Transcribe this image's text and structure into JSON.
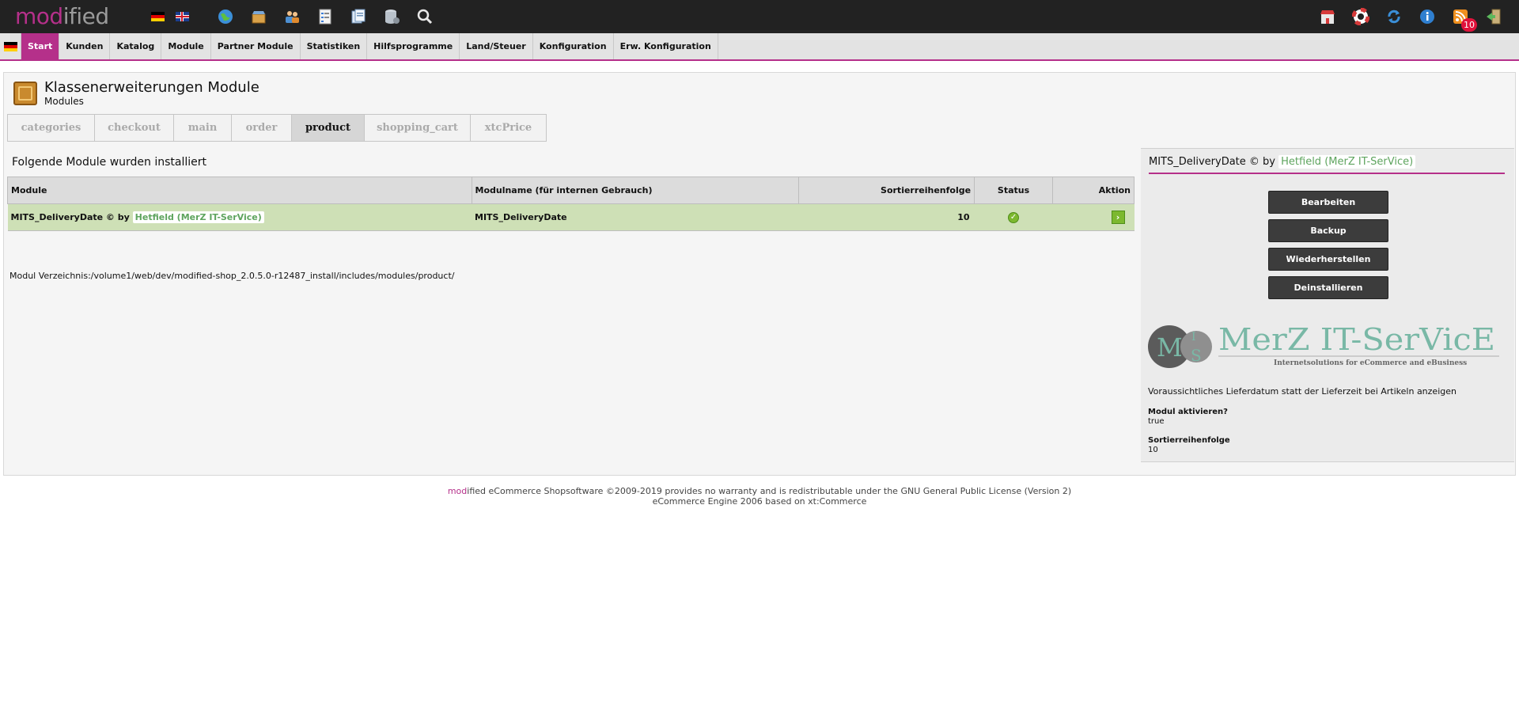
{
  "brand": {
    "logo_part1": "mod",
    "logo_part2": "ified",
    "accent": "#b5308a"
  },
  "topbar": {
    "flags": [
      "flag-de-icon",
      "flag-en-icon"
    ],
    "icons": [
      "globe-icon",
      "basket-icon",
      "users-icon",
      "checklist-icon",
      "documents-icon",
      "database-icon",
      "search-icon"
    ],
    "right_icons": [
      "shop-icon",
      "lifebuoy-icon",
      "refresh-icon",
      "info-icon",
      "rss-icon",
      "logout-icon"
    ],
    "rss_count": "10"
  },
  "nav": {
    "items": [
      "Start",
      "Kunden",
      "Katalog",
      "Module",
      "Partner Module",
      "Statistiken",
      "Hilfsprogramme",
      "Land/Steuer",
      "Konfiguration",
      "Erw. Konfiguration"
    ],
    "active": "Start"
  },
  "page": {
    "title": "Klassenerweiterungen Module",
    "subtitle": "Modules",
    "tabs": [
      "categories",
      "checkout",
      "main",
      "order",
      "product",
      "shopping_cart",
      "xtcPrice"
    ],
    "active_tab": "product",
    "installed_heading": "Folgende Module wurden installiert",
    "directory": "Modul Verzeichnis:/volume1/web/dev/modified-shop_2.0.5.0-r12487_install/includes/modules/product/"
  },
  "table": {
    "headers": {
      "module": "Module",
      "modulname": "Modulname (für internen Gebrauch)",
      "sort": "Sortierreihenfolge",
      "status": "Status",
      "action": "Aktion"
    },
    "rows": [
      {
        "module_name": "MITS_DeliveryDate © by",
        "author": "Hetfield (MerZ IT-SerVice)",
        "internal_name": "MITS_DeliveryDate",
        "sort": "10",
        "status": "active"
      }
    ]
  },
  "side": {
    "title": "MITS_DeliveryDate © by",
    "author": "Hetfield (MerZ IT-SerVice)",
    "buttons": [
      "Bearbeiten",
      "Backup",
      "Wiederherstellen",
      "Deinstallieren"
    ],
    "logo_text": "MerZ IT-SerVicE",
    "logo_tagline": "Internetsolutions for eCommerce and eBusiness",
    "logo_initials": [
      "M",
      "I",
      "S"
    ],
    "description": "Voraussichtliches Lieferdatum statt der Lieferzeit bei Artikeln anzeigen",
    "fields": [
      {
        "label": "Modul aktivieren?",
        "value": "true"
      },
      {
        "label": "Sortierreihenfolge",
        "value": "10"
      }
    ]
  },
  "footer": {
    "line1_mod": "mod",
    "line1_rest": "ified eCommerce Shopsoftware ©2009-2019 provides no warranty and is redistributable under the GNU General Public License (Version 2)",
    "line2": "eCommerce Engine 2006 based on xt:Commerce"
  }
}
